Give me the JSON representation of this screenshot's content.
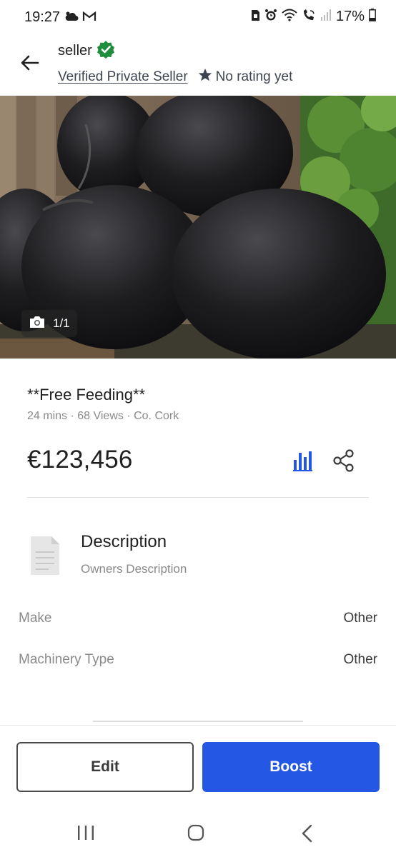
{
  "status_bar": {
    "time": "19:27",
    "battery": "17%",
    "left_icons": [
      "cloud-icon",
      "gmail-icon"
    ],
    "right_icons": [
      "sim-icon",
      "alarm-icon",
      "wifi-icon",
      "wifi-call-icon",
      "signal-icon",
      "battery-icon"
    ]
  },
  "header": {
    "seller_name": "seller",
    "verified_label": "Verified Private Seller",
    "rating_text": "No rating yet",
    "verified_color": "#1e8e3e"
  },
  "gallery": {
    "counter": "1/1"
  },
  "listing": {
    "title": "**Free Feeding**",
    "meta": "24 mins · 68 Views · Co. Cork",
    "price": "€123,456"
  },
  "description": {
    "heading": "Description",
    "text": "Owners Description"
  },
  "specs": [
    {
      "label": "Make",
      "value": "Other"
    },
    {
      "label": "Machinery Type",
      "value": "Other"
    }
  ],
  "actions": {
    "edit_label": "Edit",
    "boost_label": "Boost",
    "accent": "#2457e3"
  },
  "nav": {
    "icons": [
      "recents-icon",
      "home-icon",
      "back-icon"
    ]
  }
}
